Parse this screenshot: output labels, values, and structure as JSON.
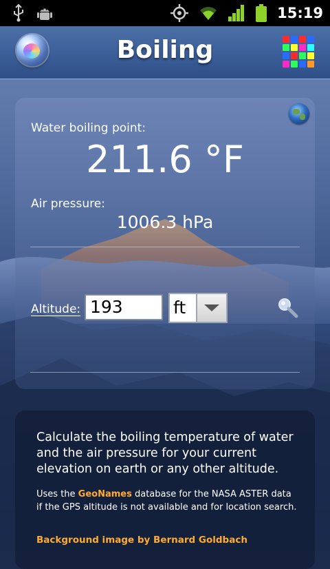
{
  "status_bar": {
    "time": "15:19",
    "icons": [
      "usb-icon",
      "android-debug-icon",
      "gps-icon",
      "wifi-icon",
      "signal-icon",
      "battery-icon"
    ]
  },
  "title_bar": {
    "title": "Boiling",
    "left_button_icon": "bubble-icon",
    "right_button_icon": "color-grid-icon",
    "grid_colors": [
      "#ff2a2a",
      "#2a6bff",
      "#ff2a2a",
      "#2a6bff",
      "#2aff5a",
      "#ffff2a",
      "#ff2ac8",
      "#2affff",
      "#2a6bff",
      "#ff2a2a",
      "#2aff5a",
      "#ffff2a",
      "#ff2ac8",
      "#2aff5a",
      "#2a6bff",
      "#ff9a2a"
    ]
  },
  "panel": {
    "boiling_label": "Water boiling point:",
    "boiling_value": "211.6 °F",
    "pressure_label": "Air pressure:",
    "pressure_value": "1006.3 hPa",
    "altitude_label": "Altitude:",
    "altitude_value": "193",
    "unit_value": "ft"
  },
  "info": {
    "main_text": "Calculate the boiling temperature of water and the air pressure for your current elevation on earth or any other altitude.",
    "small_text_prefix": "Uses the ",
    "small_text_link": "GeoNames",
    "small_text_suffix": " database for the NASA ASTER data if the GPS altitude is not available and for location search.",
    "credit": "Background image by Bernard Goldbach"
  },
  "colors": {
    "accent_orange": "#ffab2e",
    "title_bar_blue": "#3f629c",
    "status_bar_black": "#000000"
  }
}
